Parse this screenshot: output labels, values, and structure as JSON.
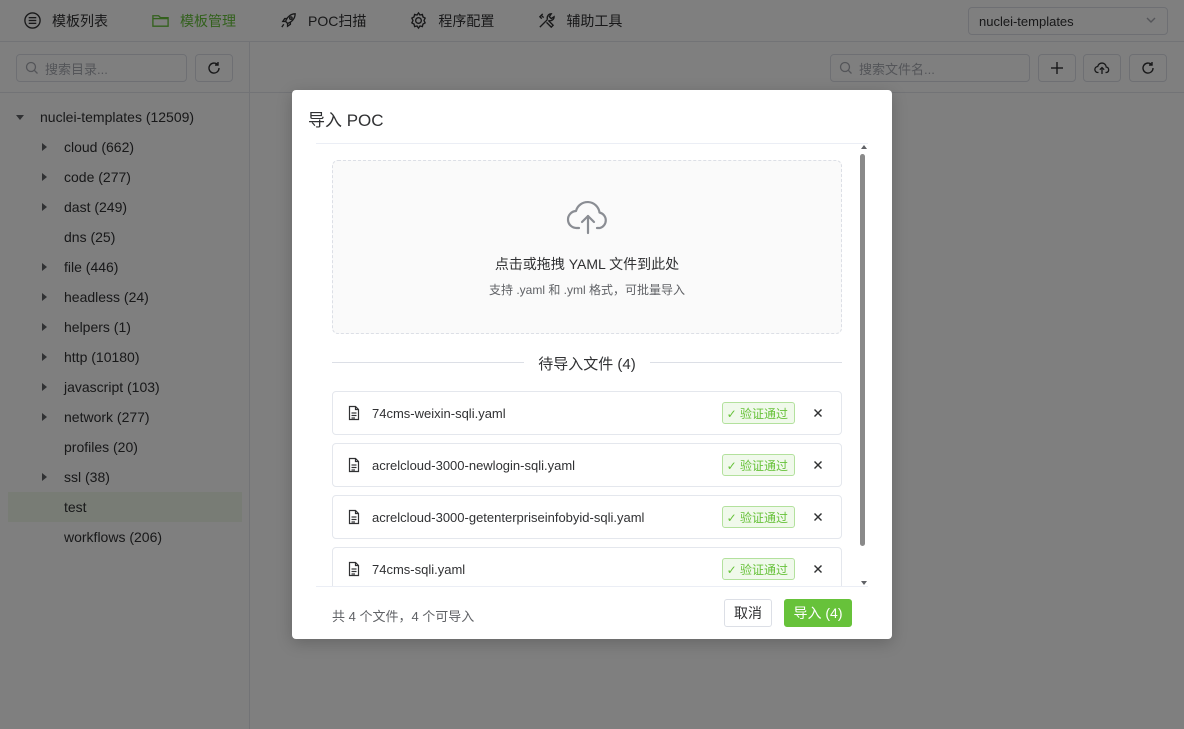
{
  "nav": {
    "items": [
      {
        "label": "模板列表",
        "icon": "list-icon",
        "active": false
      },
      {
        "label": "模板管理",
        "icon": "folder-icon",
        "active": true
      },
      {
        "label": "POC扫描",
        "icon": "rocket-icon",
        "active": false
      },
      {
        "label": "程序配置",
        "icon": "gear-icon",
        "active": false
      },
      {
        "label": "辅助工具",
        "icon": "tools-icon",
        "active": false
      }
    ],
    "repo_select": "nuclei-templates"
  },
  "sidebar": {
    "search_placeholder": "搜索目录...",
    "tree_root": "nuclei-templates (12509)",
    "items": [
      {
        "label": "cloud (662)",
        "expandable": true
      },
      {
        "label": "code (277)",
        "expandable": true
      },
      {
        "label": "dast (249)",
        "expandable": true
      },
      {
        "label": "dns (25)",
        "expandable": false
      },
      {
        "label": "file (446)",
        "expandable": true
      },
      {
        "label": "headless (24)",
        "expandable": true
      },
      {
        "label": "helpers (1)",
        "expandable": true
      },
      {
        "label": "http (10180)",
        "expandable": true
      },
      {
        "label": "javascript (103)",
        "expandable": true
      },
      {
        "label": "network (277)",
        "expandable": true
      },
      {
        "label": "profiles (20)",
        "expandable": false
      },
      {
        "label": "ssl (38)",
        "expandable": true
      },
      {
        "label": "test",
        "expandable": false,
        "selected": true
      },
      {
        "label": "workflows (206)",
        "expandable": false
      }
    ]
  },
  "main": {
    "file_search_placeholder": "搜索文件名..."
  },
  "dialog": {
    "title": "导入 POC",
    "upload_main": "点击或拖拽 YAML 文件到此处",
    "upload_sub": "支持 .yaml 和 .yml 格式，可批量导入",
    "pending_title": "待导入文件 (4)",
    "files": [
      {
        "name": "74cms-weixin-sqli.yaml",
        "status": "✓ 验证通过"
      },
      {
        "name": "acrelcloud-3000-newlogin-sqli.yaml",
        "status": "✓ 验证通过"
      },
      {
        "name": "acrelcloud-3000-getenterpriseinfobyid-sqli.yaml",
        "status": "✓ 验证通过"
      },
      {
        "name": "74cms-sqli.yaml",
        "status": "✓ 验证通过"
      }
    ],
    "summary": "共 4 个文件，4 个可导入",
    "cancel_label": "取消",
    "import_label": "导入 (4)"
  },
  "colors": {
    "accent": "#67c23a",
    "overlay": "rgba(0,0,0,0.5)"
  }
}
